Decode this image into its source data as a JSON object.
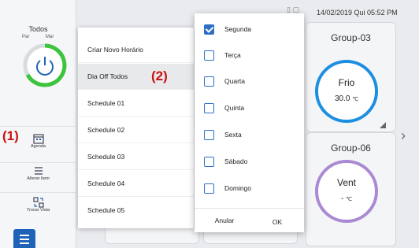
{
  "status_bar": {
    "datetime": "14/02/2019 Qui 05:52 PM"
  },
  "sidebar": {
    "title": "Todos",
    "label_left": "Par",
    "label_right": "Mar",
    "power_icon": "power-icon",
    "items": [
      {
        "label": "Agenda",
        "icon": "calendar-icon"
      },
      {
        "label": "Alterar Item",
        "icon": "list-edit-icon"
      },
      {
        "label": "Trocar Vista",
        "icon": "swap-view-icon"
      }
    ],
    "menu_icon": "hamburger-icon"
  },
  "annotations": {
    "marker_1": "(1)",
    "marker_2": "(2)",
    "marker_color": "#cc1111"
  },
  "schedule_menu": {
    "items": [
      {
        "label": "Criar Novo Horário",
        "selected": false
      },
      {
        "label": "Dia Off Todos",
        "selected": true
      },
      {
        "label": "Schedule 01",
        "selected": false
      },
      {
        "label": "Schedule 02",
        "selected": false
      },
      {
        "label": "Schedule 03",
        "selected": false
      },
      {
        "label": "Schedule 04",
        "selected": false
      },
      {
        "label": "Schedule 05",
        "selected": false
      }
    ]
  },
  "days_popup": {
    "days": [
      {
        "label": "Segunda",
        "checked": true
      },
      {
        "label": "Terça",
        "checked": false
      },
      {
        "label": "Quarta",
        "checked": false
      },
      {
        "label": "Quinta",
        "checked": false
      },
      {
        "label": "Sexta",
        "checked": false
      },
      {
        "label": "Sábado",
        "checked": false
      },
      {
        "label": "Domingo",
        "checked": false
      }
    ],
    "cancel_label": "Anular",
    "ok_label": "OK"
  },
  "groups": [
    {
      "name": "Group-03",
      "mode": "Frio",
      "temp": "30.0",
      "unit": "℃",
      "ring_color": "#1d8fe0"
    },
    {
      "name": "Group-06",
      "mode": "Vent",
      "temp": "-",
      "unit": "℃",
      "ring_color": "#a98ad3"
    }
  ],
  "colors": {
    "accent": "#1f63b8",
    "power_ring": "#3cc53c",
    "checkbox": "#2e6fc6"
  }
}
